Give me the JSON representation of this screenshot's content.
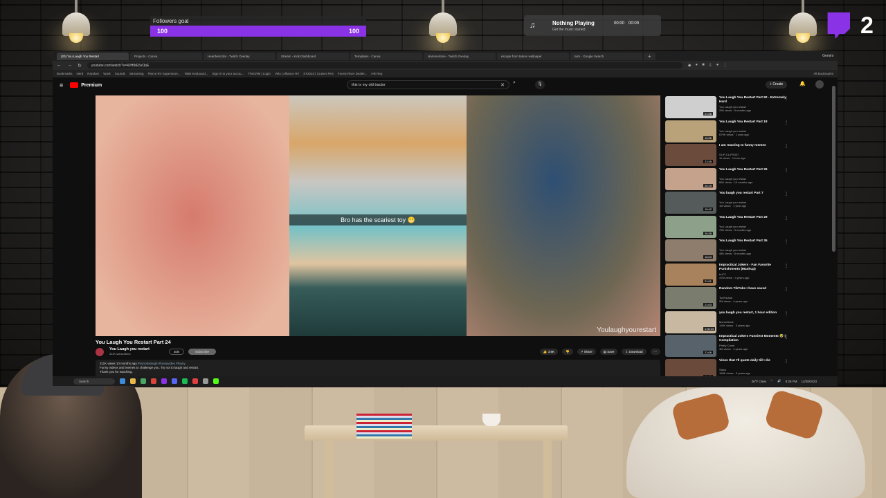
{
  "overlay": {
    "followers_goal": {
      "label": "Followers goal",
      "current": "100",
      "target": "100",
      "progress": 1.0
    },
    "now_playing": {
      "title": "Nothing Playing",
      "subtitle": "Get the music started",
      "time_current": "00:00",
      "time_total": "00:00"
    },
    "twitch": {
      "count": "2",
      "brand_color": "#8a33e6"
    }
  },
  "browser": {
    "tabs": [
      {
        "label": "(20) You Laugh You Restart",
        "active": true
      },
      {
        "label": "Projects - Canva"
      },
      {
        "label": "Heartless Bar - Twitch Overlay"
      },
      {
        "label": "Stream - Kick Dashboard"
      },
      {
        "label": "Templates - Canva"
      },
      {
        "label": "Hammertime - Twitch Overlay"
      },
      {
        "label": "escape from tarkov wallpaper"
      },
      {
        "label": "twm - Google Search"
      }
    ],
    "new_tab": "+",
    "gemini": "Gemini",
    "url": "youtube.com/watch?v=40H8rE5xOpE",
    "bookmarks": [
      "Bookmarks",
      "Nerd",
      "Random",
      "Work",
      "Sounds",
      "Streaming",
      "Pierce RV Superstore...",
      "RBN Keyboard...",
      "Sign in to your accou...",
      "TheCRM | Login",
      "Velo | Alliance RV",
      "ST2015 | Cruiser RVs",
      "Forest River Dealer...",
      "HR Rep"
    ],
    "all_bookmarks": "All Bookmarks"
  },
  "youtube": {
    "brand": "Premium",
    "search_query": "this is my old tractor",
    "create_label": "Create",
    "video": {
      "caption": "Bro has the scariest toy 😬",
      "watermark": "Youlaughyourestart",
      "title": "You Laugh You Restart Part 24",
      "channel": "You Laugh you restart",
      "subscribers": "311K subscribers",
      "join": "Join",
      "subscribe": "Subscribe",
      "likes": "3.6K",
      "share": "Share",
      "save": "Save",
      "download": "Download",
      "description": {
        "meta": "311K views  10 months ago",
        "tags": "#trynottolaugh #funnyvideo #funny",
        "line1": "Funny videos and memes to challenge you. Try not to laugh and restart.",
        "line2": "Thank you for watching."
      }
    },
    "recommendations": [
      {
        "title": "You Laugh You Restart Part 92 - Extremely Hard",
        "channel": "You Laugh you restart",
        "meta": "29K views · 9 months ago",
        "duration": "21:58",
        "color": "#cfcfcf"
      },
      {
        "title": "You Laugh You Restart Part 18",
        "channel": "You Laugh you restart",
        "meta": "679K views · 1 year ago",
        "duration": "16:56",
        "color": "#b9a27a"
      },
      {
        "title": "I am reacting to funny memes",
        "channel": "SLIP-CLIPS007",
        "meta": "11 views · 1 hour ago",
        "duration": "23:35",
        "color": "#6b4b3b"
      },
      {
        "title": "You Laugh You Restart Part 26",
        "channel": "You Laugh you restart",
        "meta": "66K views · 10 months ago",
        "duration": "20:19",
        "color": "#c4a28b"
      },
      {
        "title": "You laugh you restart Part 7",
        "channel": "You Laugh you restart",
        "meta": "1M views · 1 year ago",
        "duration": "15:42",
        "color": "#555a5a"
      },
      {
        "title": "You Laugh You Restart Part 29",
        "channel": "You Laugh you restart",
        "meta": "79K views · 9 months ago",
        "duration": "20:35",
        "color": "#8da08a"
      },
      {
        "title": "You Laugh You Restart Part 35",
        "channel": "You Laugh you restart",
        "meta": "48K views · 8 months ago",
        "duration": "18:03",
        "color": "#8e7d6d"
      },
      {
        "title": "Impractical Jokers - Fan Favorite Punishments (Mashup)",
        "channel": "truTV",
        "meta": "47M views · 4 years ago",
        "duration": "21:01",
        "color": "#a8825c"
      },
      {
        "title": "Random TikToks I have saved",
        "channel": "TimPadtub",
        "meta": "2M views · 4 years ago",
        "duration": "21:03",
        "color": "#7a7c6e"
      },
      {
        "title": "you laugh you restart, 1 hour edition",
        "channel": "Memeblank",
        "meta": "119K views · 3 years ago",
        "duration": "1:00:29",
        "color": "#c8b8a2"
      },
      {
        "title": "Impractical Jokers Funniest Moments 🤣 | Compilation",
        "channel": "Pretty Come",
        "meta": "3M views · 4 years ago",
        "duration": "21:06",
        "color": "#58626a"
      },
      {
        "title": "Vines that I'll quote daily till I die",
        "channel": "Stans",
        "meta": "168K views · 3 years ago",
        "duration": "11:05",
        "color": "#6a4a3a"
      }
    ]
  },
  "taskbar": {
    "search": "Search",
    "weather": "26°F Clear",
    "time": "8:25 PM",
    "date": "12/28/2023"
  }
}
